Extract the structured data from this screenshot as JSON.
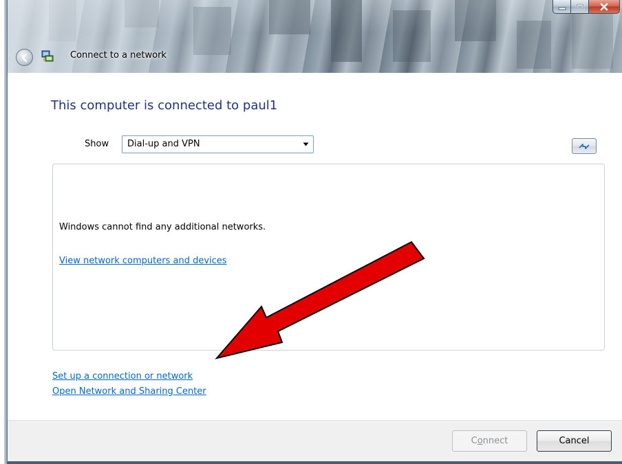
{
  "window": {
    "title": "Connect to a network"
  },
  "heading": "This computer is connected to paul1",
  "filter": {
    "label": "Show",
    "selected": "Dial-up and VPN"
  },
  "network_list": {
    "message": "Windows cannot find any additional networks.",
    "view_link": "View network computers and devices"
  },
  "links": {
    "setup": "Set up a connection or network",
    "sharing_center": "Open Network and Sharing Center"
  },
  "buttons": {
    "connect_pre": "C",
    "connect_underlined": "o",
    "connect_post": "nnect",
    "cancel": "Cancel"
  },
  "colors": {
    "heading": "#1e3287",
    "link": "#0066cc",
    "annotation_arrow": "#e30000"
  },
  "icons": {
    "back": "back-arrow-icon",
    "network": "network-icon",
    "refresh": "refresh-icon",
    "dropdown": "chevron-down-icon"
  }
}
